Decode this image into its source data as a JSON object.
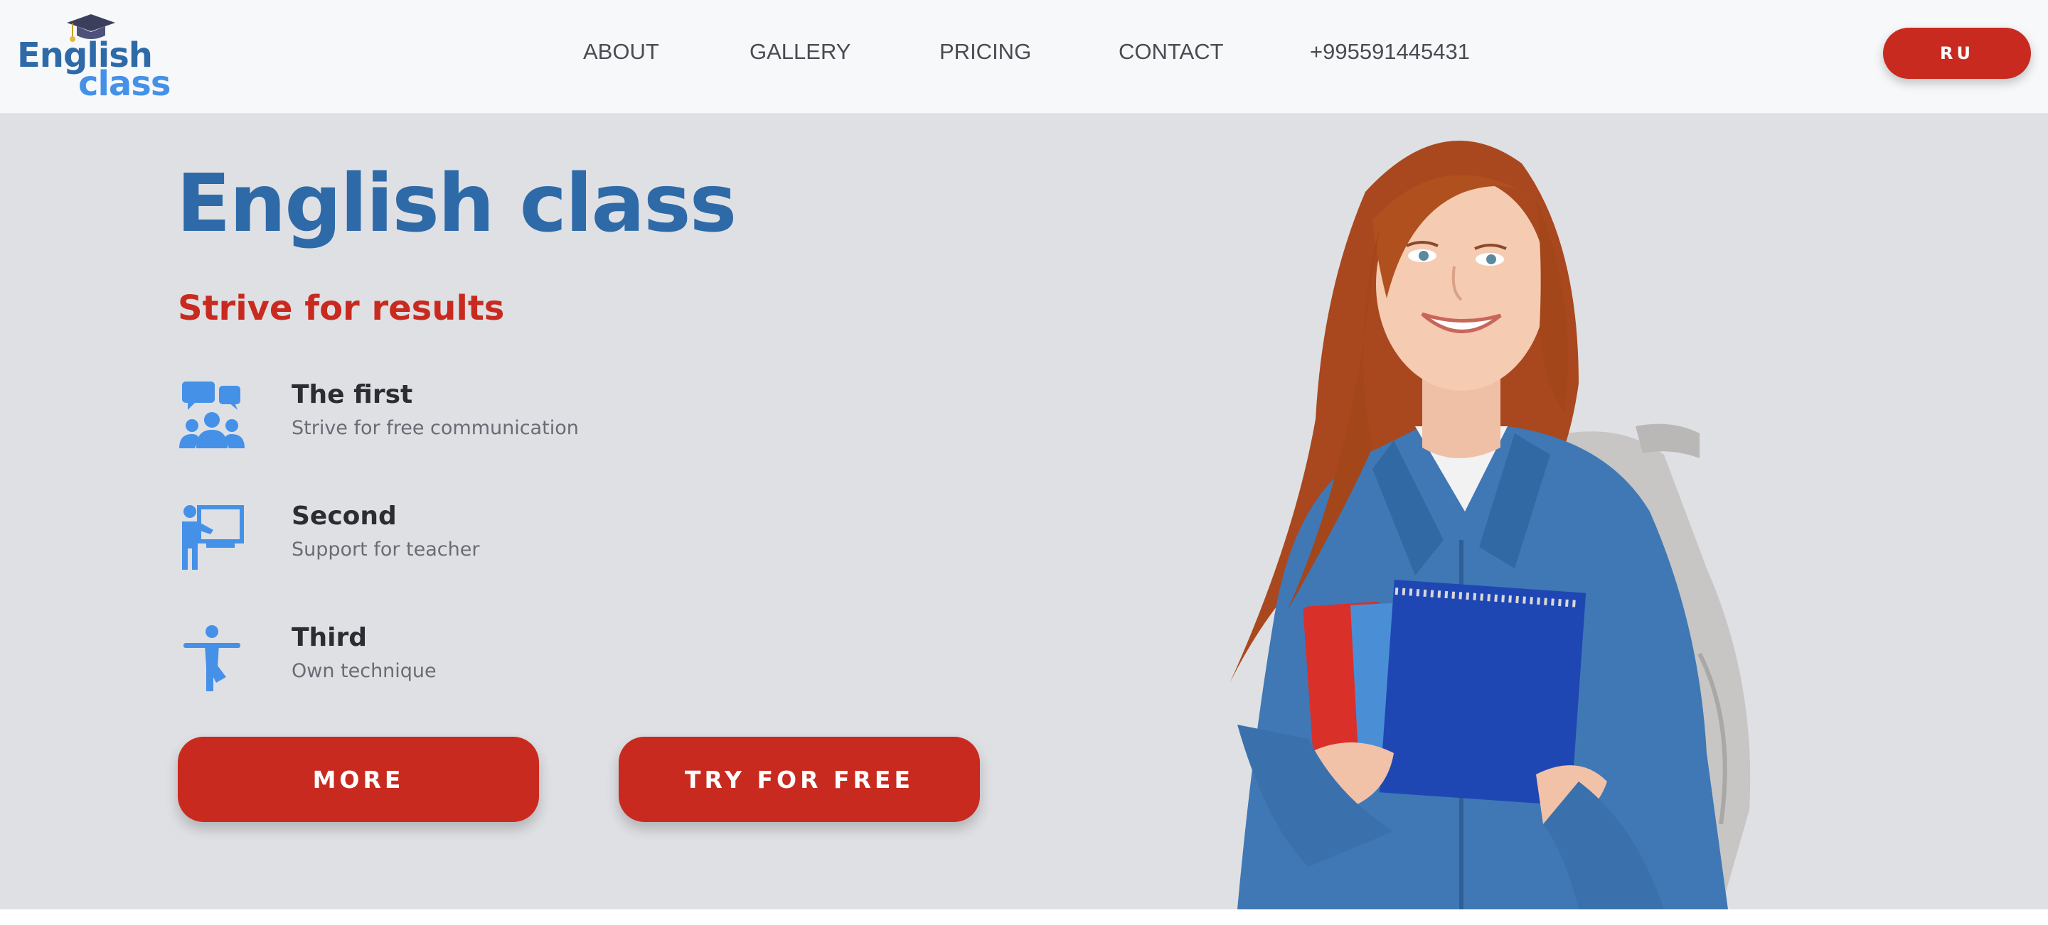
{
  "brand": {
    "line1": "English",
    "line2": "class",
    "icon": "graduation-cap-icon"
  },
  "nav": {
    "items": [
      {
        "label": "ABOUT"
      },
      {
        "label": "GALLERY"
      },
      {
        "label": "PRICING"
      },
      {
        "label": "CONTACT"
      },
      {
        "label": "+995591445431"
      }
    ],
    "language_button": "RU"
  },
  "hero": {
    "title": "English class",
    "subtitle": "Strive for results",
    "features": [
      {
        "title": "The first",
        "text": "Strive for free communication",
        "icon": "group-chat-icon"
      },
      {
        "title": "Second",
        "text": "Support for teacher",
        "icon": "teacher-board-icon"
      },
      {
        "title": "Third",
        "text": "Own technique",
        "icon": "person-exercise-icon"
      }
    ],
    "buttons": {
      "more": "MORE",
      "try_free": "TRY FOR FREE"
    },
    "image": "smiling-student-with-notebooks-and-backpack"
  },
  "colors": {
    "brand_blue": "#2e6aa8",
    "accent_blue": "#4591e8",
    "accent_red": "#c92a1f",
    "hero_bg": "#dfe0e4",
    "header_bg": "#f7f8fa"
  }
}
